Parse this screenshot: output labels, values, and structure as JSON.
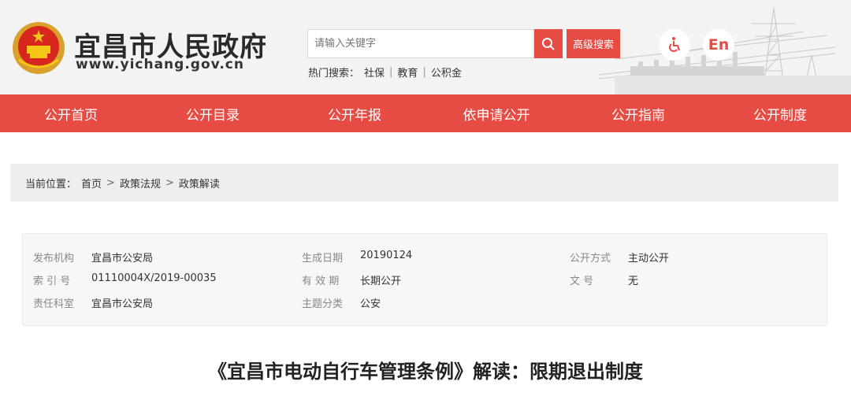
{
  "header": {
    "site_title": "宜昌市人民政府",
    "site_url": "www.yichang.gov.cn",
    "search_placeholder": "请输入关键字",
    "advanced_search": "高级搜索",
    "hot_label": "热门搜索：",
    "hot_keywords": [
      "社保",
      "教育",
      "公积金"
    ],
    "accessibility_icon": "wheelchair-icon",
    "english_label": "En",
    "accent_color": "#e74c44"
  },
  "nav": {
    "items": [
      "公开首页",
      "公开目录",
      "公开年报",
      "依申请公开",
      "公开指南",
      "公开制度"
    ]
  },
  "breadcrumb": {
    "label": "当前位置：",
    "items": [
      "首页",
      "政策法规",
      "政策解读"
    ],
    "separator": ">"
  },
  "meta": {
    "publisher_label": "发布机构",
    "publisher": "宜昌市公安局",
    "date_label": "生成日期",
    "date": "20190124",
    "mode_label": "公开方式",
    "mode": "主动公开",
    "index_label": "索 引 号",
    "index": "01110004X/2019-00035",
    "validity_label": "有 效 期",
    "validity": "长期公开",
    "doc_no_label": "文 号",
    "doc_no": "无",
    "dept_label": "责任科室",
    "dept": "宜昌市公安局",
    "topic_label": "主题分类",
    "topic": "公安"
  },
  "article": {
    "title": "《宜昌市电动自行车管理条例》解读：限期退出制度"
  }
}
